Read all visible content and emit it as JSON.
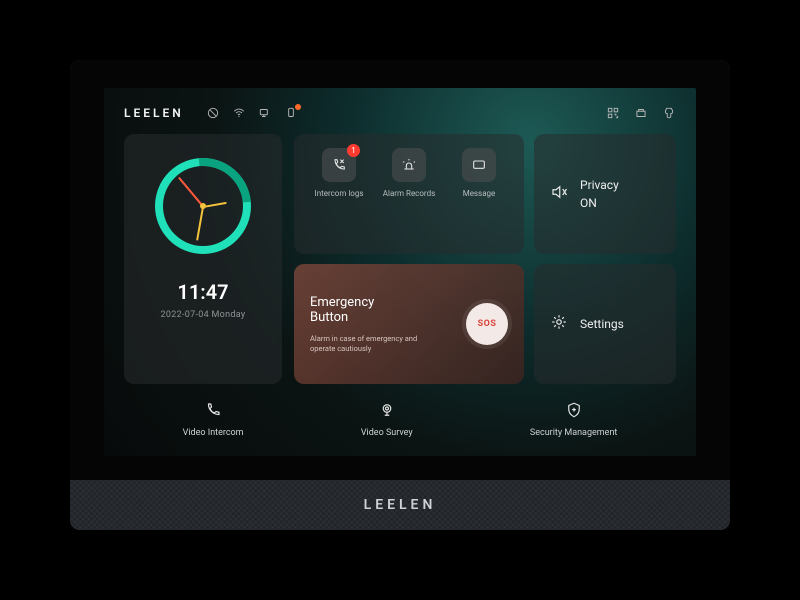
{
  "brand": "LEELEN",
  "clock": {
    "time": "11:47",
    "date": "2022-07-04  Monday"
  },
  "tiles": {
    "intercom_logs": {
      "label": "Intercom logs",
      "badge": "1"
    },
    "alarm_records": {
      "label": "Alarm Records"
    },
    "message": {
      "label": "Message"
    }
  },
  "privacy": {
    "title": "Privacy",
    "state": "ON"
  },
  "emergency": {
    "title": "Emergency\nButton",
    "subtitle": "Alarm in case of emergency and operate cautiously",
    "sos": "SOS"
  },
  "settings": {
    "label": "Settings"
  },
  "bottom": {
    "video_intercom": "Video Intercom",
    "video_survey": "Video Survey",
    "security_mgmt": "Security Management"
  }
}
